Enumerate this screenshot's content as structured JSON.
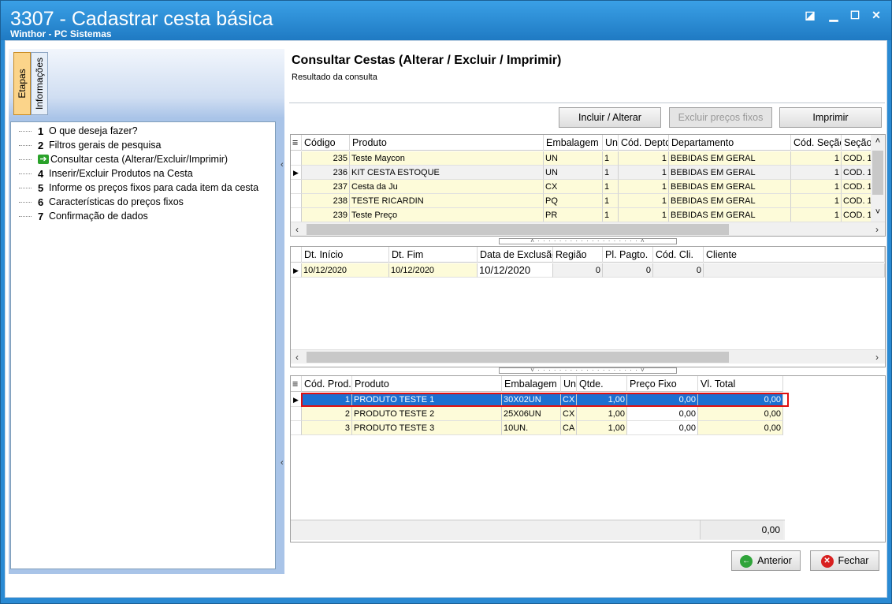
{
  "window": {
    "title": "3307 - Cadastrar cesta básica",
    "subtitle": "Winthor - PC Sistemas",
    "controls": [
      "restore-icon",
      "minimize-icon",
      "maximize-icon",
      "close-icon"
    ]
  },
  "sidebar": {
    "tabs": [
      "Etapas",
      "Informações"
    ],
    "steps": [
      {
        "num": "1",
        "label": "O que deseja fazer?"
      },
      {
        "num": "2",
        "label": "Filtros gerais de pesquisa"
      },
      {
        "num": "",
        "label": "Consultar cesta (Alterar/Excluir/Imprimir)",
        "current": true
      },
      {
        "num": "4",
        "label": "Inserir/Excluir Produtos na Cesta"
      },
      {
        "num": "5",
        "label": "Informe os preços fixos para cada item da cesta"
      },
      {
        "num": "6",
        "label": "Características do preços fixos"
      },
      {
        "num": "7",
        "label": "Confirmação de dados"
      }
    ]
  },
  "main": {
    "title": "Consultar Cestas (Alterar / Excluir / Imprimir)",
    "subtitle": "Resultado da consulta",
    "buttons": {
      "incluir": "Incluir / Alterar",
      "excluir": "Excluir preços fixos",
      "imprimir": "Imprimir"
    }
  },
  "grid1": {
    "headers": [
      "Código",
      "Produto",
      "Embalagem",
      "Un",
      "Cód. Depto",
      "Departamento",
      "Cód. Seção",
      "Seção"
    ],
    "rows": [
      [
        "235",
        "Teste Maycon",
        "UN",
        "1",
        "1",
        "BEBIDAS EM GERAL",
        "1",
        "COD. 1"
      ],
      [
        "236",
        "KIT CESTA ESTOQUE",
        "UN",
        "1",
        "1",
        "BEBIDAS EM GERAL",
        "1",
        "COD. 1"
      ],
      [
        "237",
        "Cesta da Ju",
        "CX",
        "1",
        "1",
        "BEBIDAS EM GERAL",
        "1",
        "COD. 1"
      ],
      [
        "238",
        "TESTE RICARDIN",
        "PQ",
        "1",
        "1",
        "BEBIDAS EM GERAL",
        "1",
        "COD. 1"
      ],
      [
        "239",
        "Teste Preço",
        "PR",
        "1",
        "1",
        "BEBIDAS EM GERAL",
        "1",
        "COD. 1"
      ]
    ]
  },
  "grid2": {
    "headers": [
      "Dt. Início",
      "Dt. Fim",
      "Data de Exclusão",
      "Região",
      "Pl. Pagto.",
      "Cód. Cli.",
      "Cliente"
    ],
    "rows": [
      [
        "10/12/2020",
        "10/12/2020",
        "10/12/2020",
        "0",
        "0",
        "0",
        ""
      ]
    ]
  },
  "grid3": {
    "headers": [
      "Cód. Prod.",
      "Produto",
      "Embalagem",
      "Un",
      "Qtde.",
      "Preço Fixo",
      "Vl. Total"
    ],
    "rows": [
      [
        "1",
        "PRODUTO TESTE 1",
        "30X02UN",
        "CX",
        "1,00",
        "0,00",
        "0,00"
      ],
      [
        "2",
        "PRODUTO TESTE 2",
        "25X06UN",
        "CX",
        "1,00",
        "0,00",
        "0,00"
      ],
      [
        "3",
        "PRODUTO TESTE 3",
        "10UN.",
        "CA",
        "1,00",
        "0,00",
        "0,00"
      ]
    ],
    "total": "0,00"
  },
  "footer": {
    "anterior": "Anterior",
    "fechar": "Fechar"
  }
}
